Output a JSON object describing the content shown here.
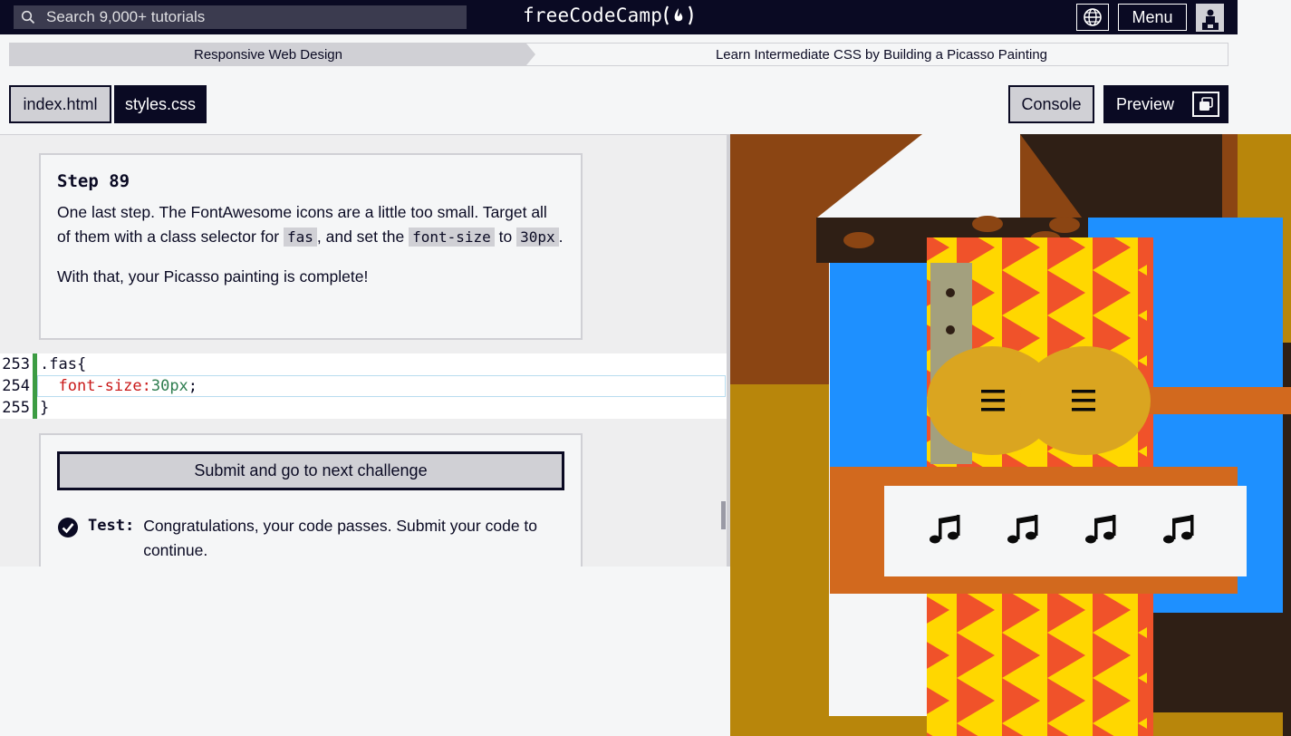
{
  "nav": {
    "search_placeholder": "Search 9,000+ tutorials",
    "logo_text": "freeCodeCamp",
    "menu_label": "Menu",
    "icons": [
      "search-icon",
      "flame-icon",
      "globe-icon",
      "avatar"
    ]
  },
  "breadcrumb": {
    "course": "Responsive Web Design",
    "project": "Learn Intermediate CSS by Building a Picasso Painting"
  },
  "tabs": {
    "index": "index.html",
    "styles": "styles.css",
    "console": "Console",
    "preview": "Preview"
  },
  "step": {
    "title": "Step 89",
    "text_1": "One last step. The FontAwesome icons are a little too small. Target all of them with a class selector for ",
    "code_1": "fas",
    "text_2": ", and set the ",
    "code_2": "font-size",
    "text_3": " to ",
    "code_3": "30px",
    "text_4": ".",
    "conclusion": "With that, your Picasso painting is complete!"
  },
  "editor": {
    "lines": [
      {
        "num": "253",
        "selector": ".fas",
        "brace": "{"
      },
      {
        "num": "254",
        "indent": "  ",
        "prop": "font-size:",
        "val": "30px",
        "end": ";"
      },
      {
        "num": "255",
        "brace": "}"
      }
    ]
  },
  "submit": {
    "button_label": "Submit and go to next challenge",
    "test_label": "Test:",
    "test_text": "Congratulations, your code passes. Submit your code to continue."
  },
  "colors": {
    "nav_bg": "#0a0a23",
    "gutter_green": "#3c9c43",
    "painting_brown": "#8b4513",
    "painting_tan": "#b8860b",
    "painting_blue": "#1e90ff",
    "painting_orange": "#d2691e",
    "painting_yellow": "#ffd700",
    "painting_red": "#f0522a",
    "painting_guitar": "#daa520",
    "painting_dark": "#2f1f15"
  }
}
